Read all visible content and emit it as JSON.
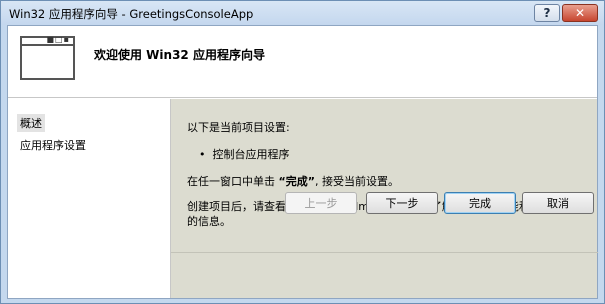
{
  "window": {
    "title": "Win32 应用程序向导 - GreetingsConsoleApp",
    "help_label": "?",
    "close_label": "✕"
  },
  "banner": {
    "title": "欢迎使用 Win32 应用程序向导"
  },
  "sidebar": {
    "items": [
      {
        "label": "概述",
        "selected": true
      },
      {
        "label": "应用程序设置",
        "selected": false
      }
    ]
  },
  "main": {
    "intro": "以下是当前项目设置:",
    "bullet": "控制台应用程序",
    "finish_before": "在任一窗口中单击 ",
    "finish_bold": "“完成”",
    "finish_after": ", 接受当前设置。",
    "readme": "创建项目后，请查看该项目的 readme.txt 文件以了解有关项目功能和生成的文件的信息。"
  },
  "buttons": {
    "prev": "上一步",
    "next": "下一步",
    "finish": "完成",
    "cancel": "取消"
  }
}
